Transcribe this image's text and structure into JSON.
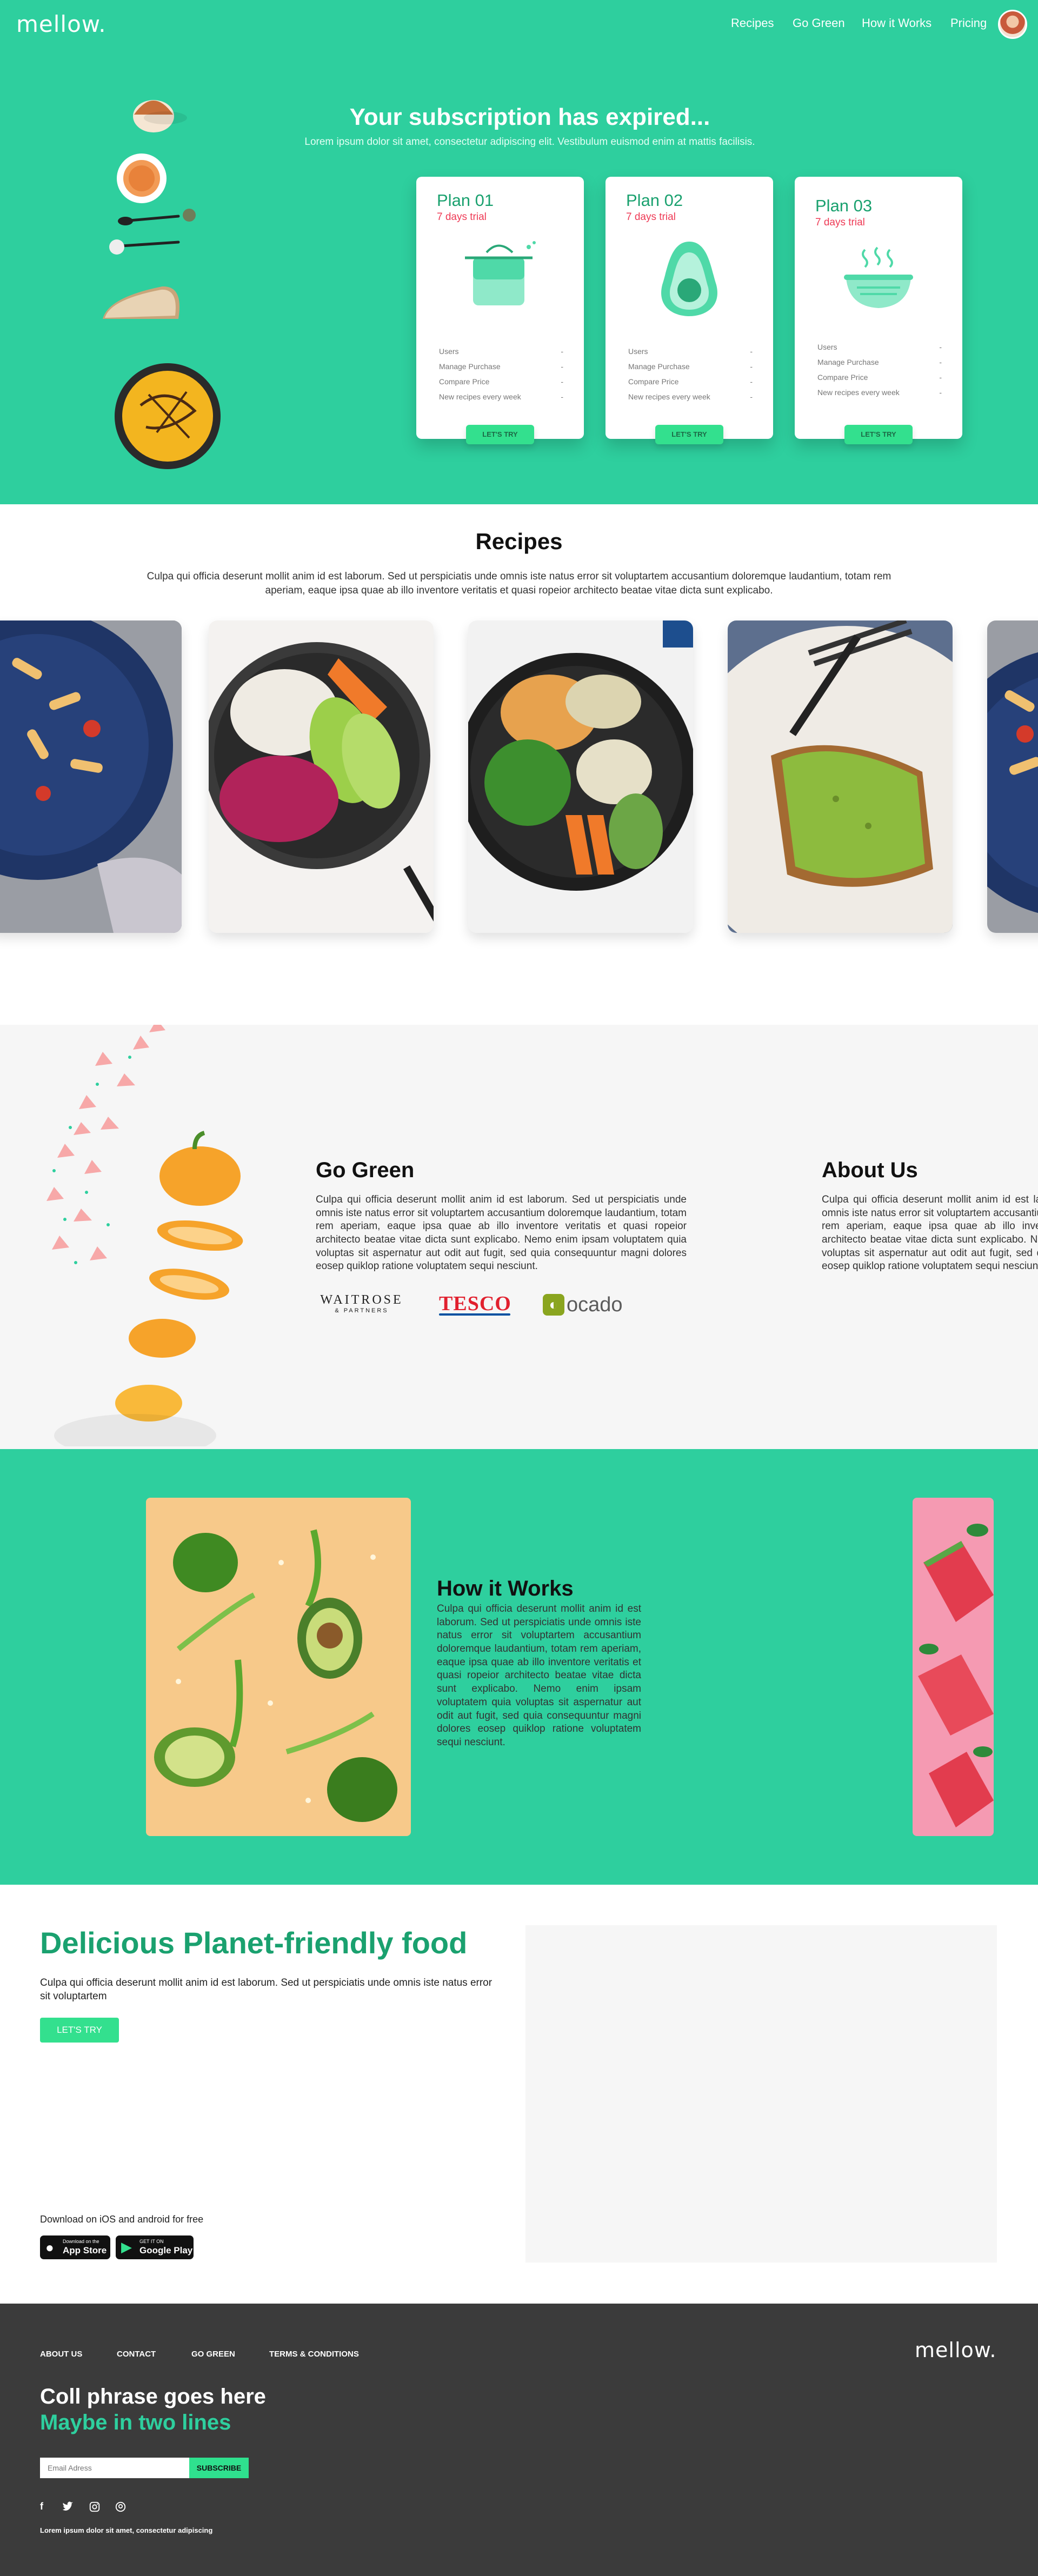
{
  "header": {
    "logo": "mellow.",
    "nav": [
      "Recipes",
      "Go Green",
      "How it Works",
      "Pricing"
    ]
  },
  "hero": {
    "title": "Your subscription has expired...",
    "subtitle": "Lorem ipsum dolor sit amet, consectetur adipiscing elit. Vestibulum euismod enim at mattis facilisis.",
    "plans": [
      {
        "name": "Plan 01",
        "trial": "7 days trial",
        "features": [
          "Users",
          "Manage Purchase",
          "Compare Price",
          "New recipes every week"
        ],
        "dash": "-",
        "button": "LET'S TRY"
      },
      {
        "name": "Plan 02",
        "trial": "7 days trial",
        "features": [
          "Users",
          "Manage Purchase",
          "Compare Price",
          "New recipes every week"
        ],
        "dash": "-",
        "button": "LET'S TRY"
      },
      {
        "name": "Plan 03",
        "trial": "7 days trial",
        "features": [
          "Users",
          "Manage Purchase",
          "Compare Price",
          "New recipes every week"
        ],
        "dash": "-",
        "button": "LET'S TRY"
      }
    ]
  },
  "recipes": {
    "title": "Recipes",
    "text": "Culpa qui officia deserunt mollit anim id est laborum. Sed ut perspiciatis unde omnis iste natus error sit voluptartem accusantium doloremque laudantium, totam rem aperiam, eaque ipsa quae ab illo inventore veritatis et quasi ropeior architecto beatae vitae dicta sunt explicabo."
  },
  "gogreen": {
    "title": "Go Green",
    "text": "Culpa qui officia deserunt mollit anim id est laborum. Sed ut perspiciatis unde omnis iste natus error sit voluptartem accusantium doloremque laudantium, totam rem aperiam, eaque ipsa quae ab illo inventore veritatis et quasi ropeior architecto beatae vitae dicta sunt explicabo. Nemo enim ipsam voluptatem quia voluptas sit aspernatur aut odit aut fugit, sed quia consequuntur magni dolores eosep quiklop ratione voluptatem sequi nesciunt.",
    "partners": [
      "WAITROSE",
      "& PARTNERS",
      "TESCO",
      "ocado"
    ],
    "about_title": "About Us",
    "about_text": "Culpa qui officia deserunt mollit anim id est laborum. Sed ut perspiciatis unde omnis iste natus error sit voluptartem accusantium doloremque laudantium, totam rem aperiam, eaque ipsa quae ab illo inventore veritatis et quasi ropeior architecto beatae vitae dicta sunt explicabo. Nemo enim ipsam voluptatem quia voluptas sit aspernatur aut odit aut fugit, sed quia consequuntur magni dolores eosep quiklop ratione voluptatem sequi nesciunt."
  },
  "how": {
    "title": "How it Works",
    "text": "Culpa qui officia deserunt mollit anim id est laborum. Sed ut perspiciatis unde omnis iste natus error sit voluptartem accusantium doloremque laudantium, totam rem aperiam, eaque ipsa quae ab illo inventore veritatis et quasi ropeior architecto beatae vitae dicta sunt explicabo. Nemo enim ipsam voluptatem quia voluptas sit aspernatur aut odit aut fugit, sed quia consequuntur magni dolores eosep quiklop ratione voluptatem sequi nesciunt."
  },
  "delicious": {
    "title": "Delicious Planet-friendly food",
    "text": "Culpa qui officia deserunt mollit anim id est laborum. Sed ut perspiciatis unde omnis iste natus error sit voluptartem",
    "button": "LET'S TRY",
    "download": "Download on iOS and android for free",
    "appstore_small": "Download on the",
    "appstore": "App Store",
    "googleplay_small": "GET IT ON",
    "googleplay": "Google Play"
  },
  "footer": {
    "links": [
      "ABOUT US",
      "CONTACT",
      "GO GREEN",
      "TERMS & CONDITIONS"
    ],
    "logo": "mellow.",
    "call1": "Coll phrase goes here",
    "call2": "Maybe in two lines",
    "email_placeholder": "Email Adress",
    "subscribe": "SUBSCRIBE",
    "note": "Lorem ipsum dolor sit amet, consectetur adipiscing"
  },
  "colors": {
    "brand": "#2ecf9e",
    "accent": "#33e08e",
    "trial": "#ee3a55",
    "dark": "#3b3b3b"
  }
}
